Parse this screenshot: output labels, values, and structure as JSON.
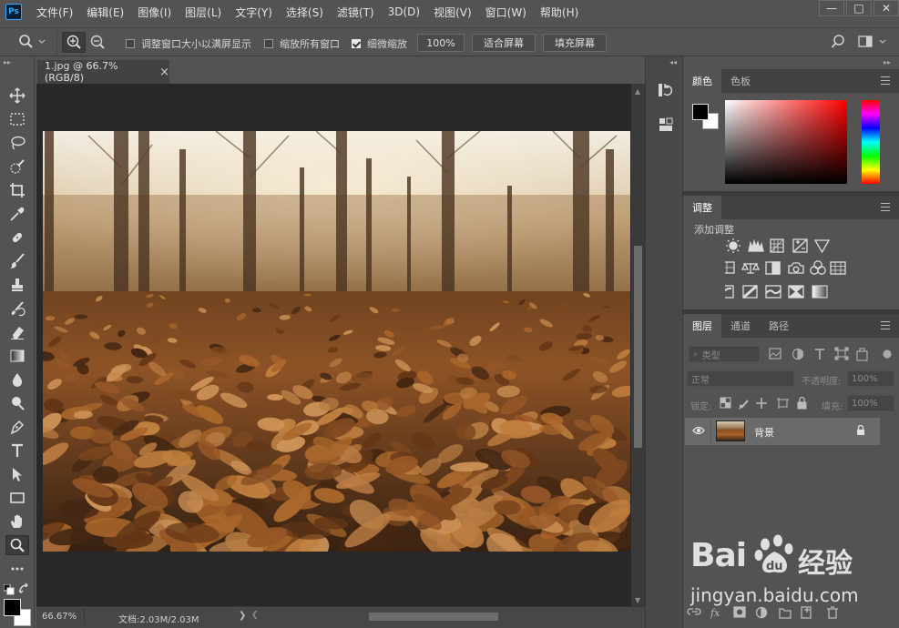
{
  "app": {
    "logo": "Ps",
    "menu": [
      "文件(F)",
      "编辑(E)",
      "图像(I)",
      "图层(L)",
      "文字(Y)",
      "选择(S)",
      "滤镜(T)",
      "3D(D)",
      "视图(V)",
      "窗口(W)",
      "帮助(H)"
    ],
    "window_controls": [
      "—",
      "□",
      "✕"
    ]
  },
  "options": {
    "resize_windows_label": "调整窗口大小以满屏显示",
    "resize_windows_checked": false,
    "zoom_all_label": "缩放所有窗口",
    "zoom_all_checked": false,
    "scrubby_label": "细微缩放",
    "scrubby_checked": true,
    "zoom_value": "100%",
    "fit_screen_label": "适合屏幕",
    "fill_screen_label": "填充屏幕"
  },
  "tools": [
    "move-icon",
    "marquee-icon",
    "lasso-icon",
    "quick-select-icon",
    "crop-icon",
    "eyedropper-icon",
    "healing-icon",
    "brush-icon",
    "stamp-icon",
    "history-brush-icon",
    "eraser-icon",
    "gradient-icon",
    "blur-icon",
    "dodge-icon",
    "pen-icon",
    "type-icon",
    "path-select-icon",
    "rectangle-icon",
    "hand-icon",
    "zoom-icon",
    "more-tools-icon"
  ],
  "document": {
    "tab_title": "1.jpg @ 66.7%(RGB/8)",
    "close_glyph": "×",
    "zoom_status": "66.67%",
    "doc_size": "文档:2.03M/2.03M"
  },
  "color_panel": {
    "tabs": [
      "颜色",
      "色板"
    ],
    "foreground": "#000000",
    "background": "#ffffff",
    "hue": "#ff0000"
  },
  "adjustments_panel": {
    "tab": "调整",
    "add_label": "添加调整"
  },
  "layers_panel": {
    "tabs": [
      "图层",
      "通道",
      "路径"
    ],
    "filter_placeholder": "类型",
    "blend_mode": "正常",
    "opacity_label": "不透明度:",
    "opacity_value": "100%",
    "lock_label": "锁定:",
    "fill_label": "填充:",
    "fill_value": "100%",
    "layers": [
      {
        "name": "背景",
        "visible": true,
        "locked": true
      }
    ]
  },
  "watermark": {
    "brand": "Bai",
    "brand2": "du",
    "site_name": "经验",
    "url": "jingyan.baidu.com"
  }
}
